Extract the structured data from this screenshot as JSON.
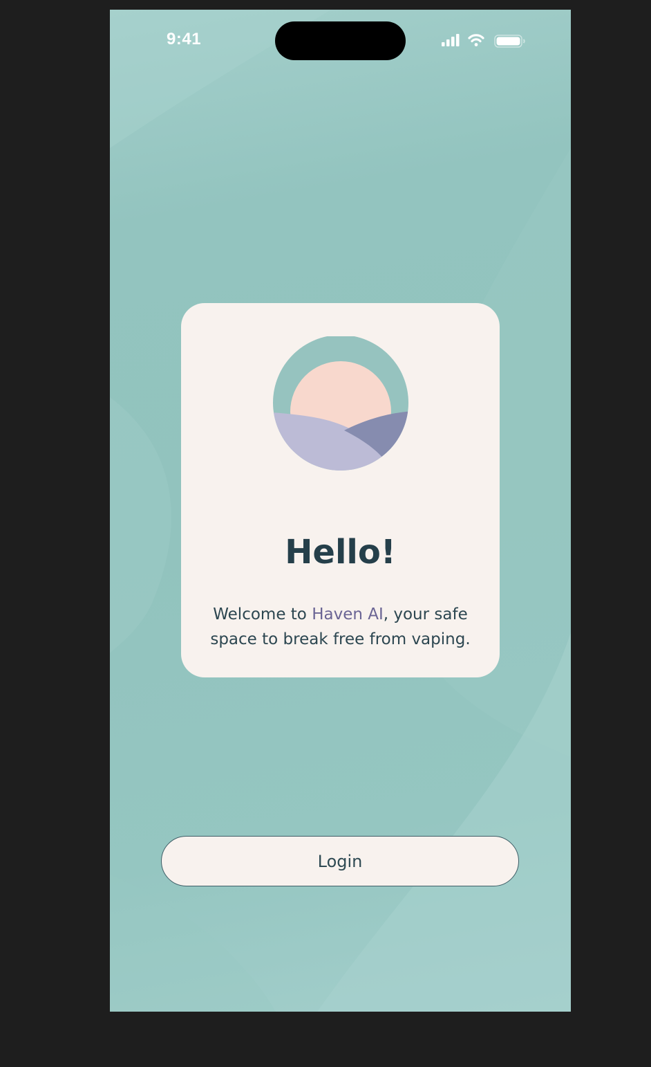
{
  "status_bar": {
    "time": "9:41",
    "icons": [
      "cellular-signal-icon",
      "wifi-icon",
      "battery-icon"
    ]
  },
  "card": {
    "logo": "haven-sunrise-logo",
    "title": "Hello!",
    "subtitle_prefix": "Welcome to ",
    "brand_name": "Haven AI",
    "subtitle_suffix": ", your safe space to break free from vaping."
  },
  "actions": {
    "login_label": "Login"
  },
  "colors": {
    "background_teal": "#93c4bf",
    "card_background": "#f8f2ee",
    "title_text": "#253f4a",
    "brand_accent": "#6a6494",
    "logo_ring": "#96c3bf",
    "logo_sun": "#f8d8cd",
    "logo_hill_light": "#bcbbd6",
    "logo_hill_dark": "#868caf"
  }
}
